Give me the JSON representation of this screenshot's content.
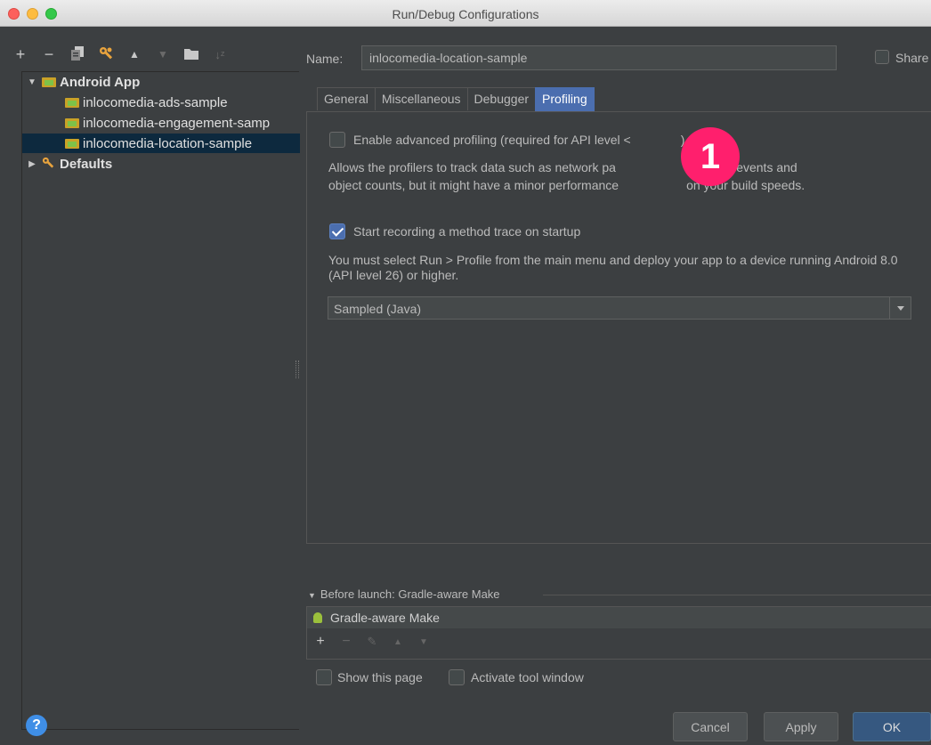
{
  "window": {
    "title": "Run/Debug Configurations"
  },
  "toolbar": {
    "icons": [
      "add-icon",
      "remove-icon",
      "copy-icon",
      "wrench-icon",
      "move-up-icon",
      "move-down-icon",
      "folder-icon",
      "sort-icon"
    ]
  },
  "tree": {
    "android_app": "Android App",
    "items": [
      "inlocomedia-ads-sample",
      "inlocomedia-engagement-samp",
      "inlocomedia-location-sample"
    ],
    "selected": "inlocomedia-location-sample",
    "defaults": "Defaults"
  },
  "config": {
    "name_label": "Name:",
    "name_value": "inlocomedia-location-sample",
    "share_label": "Share"
  },
  "tabs": [
    "General",
    "Miscellaneous",
    "Debugger",
    "Profiling"
  ],
  "active_tab": "Profiling",
  "profiling": {
    "advanced_label": "Enable advanced profiling (required for API level <",
    "advanced_label_tail": ")",
    "advanced_checked": false,
    "advanced_desc": "Allows the profilers to track data such as network pa",
    "advanced_desc_b": "plication events and",
    "advanced_desc_c": "object counts, but it might have a minor performance",
    "advanced_desc_d": "on your build speeds.",
    "trace_label": "Start recording a method trace on startup",
    "trace_checked": true,
    "trace_desc": "You must select Run > Profile from the main menu and deploy your app to a device running Android 8.0 (API level 26) or higher.",
    "trace_mode": "Sampled (Java)"
  },
  "badge": {
    "number": "1",
    "color": "#ff1f6d"
  },
  "before_launch": {
    "header": "Before launch: Gradle-aware Make",
    "task": "Gradle-aware Make",
    "show_page_label": "Show this page",
    "activate_label": "Activate tool window"
  },
  "buttons": {
    "help": "?",
    "cancel": "Cancel",
    "apply": "Apply",
    "ok": "OK"
  }
}
